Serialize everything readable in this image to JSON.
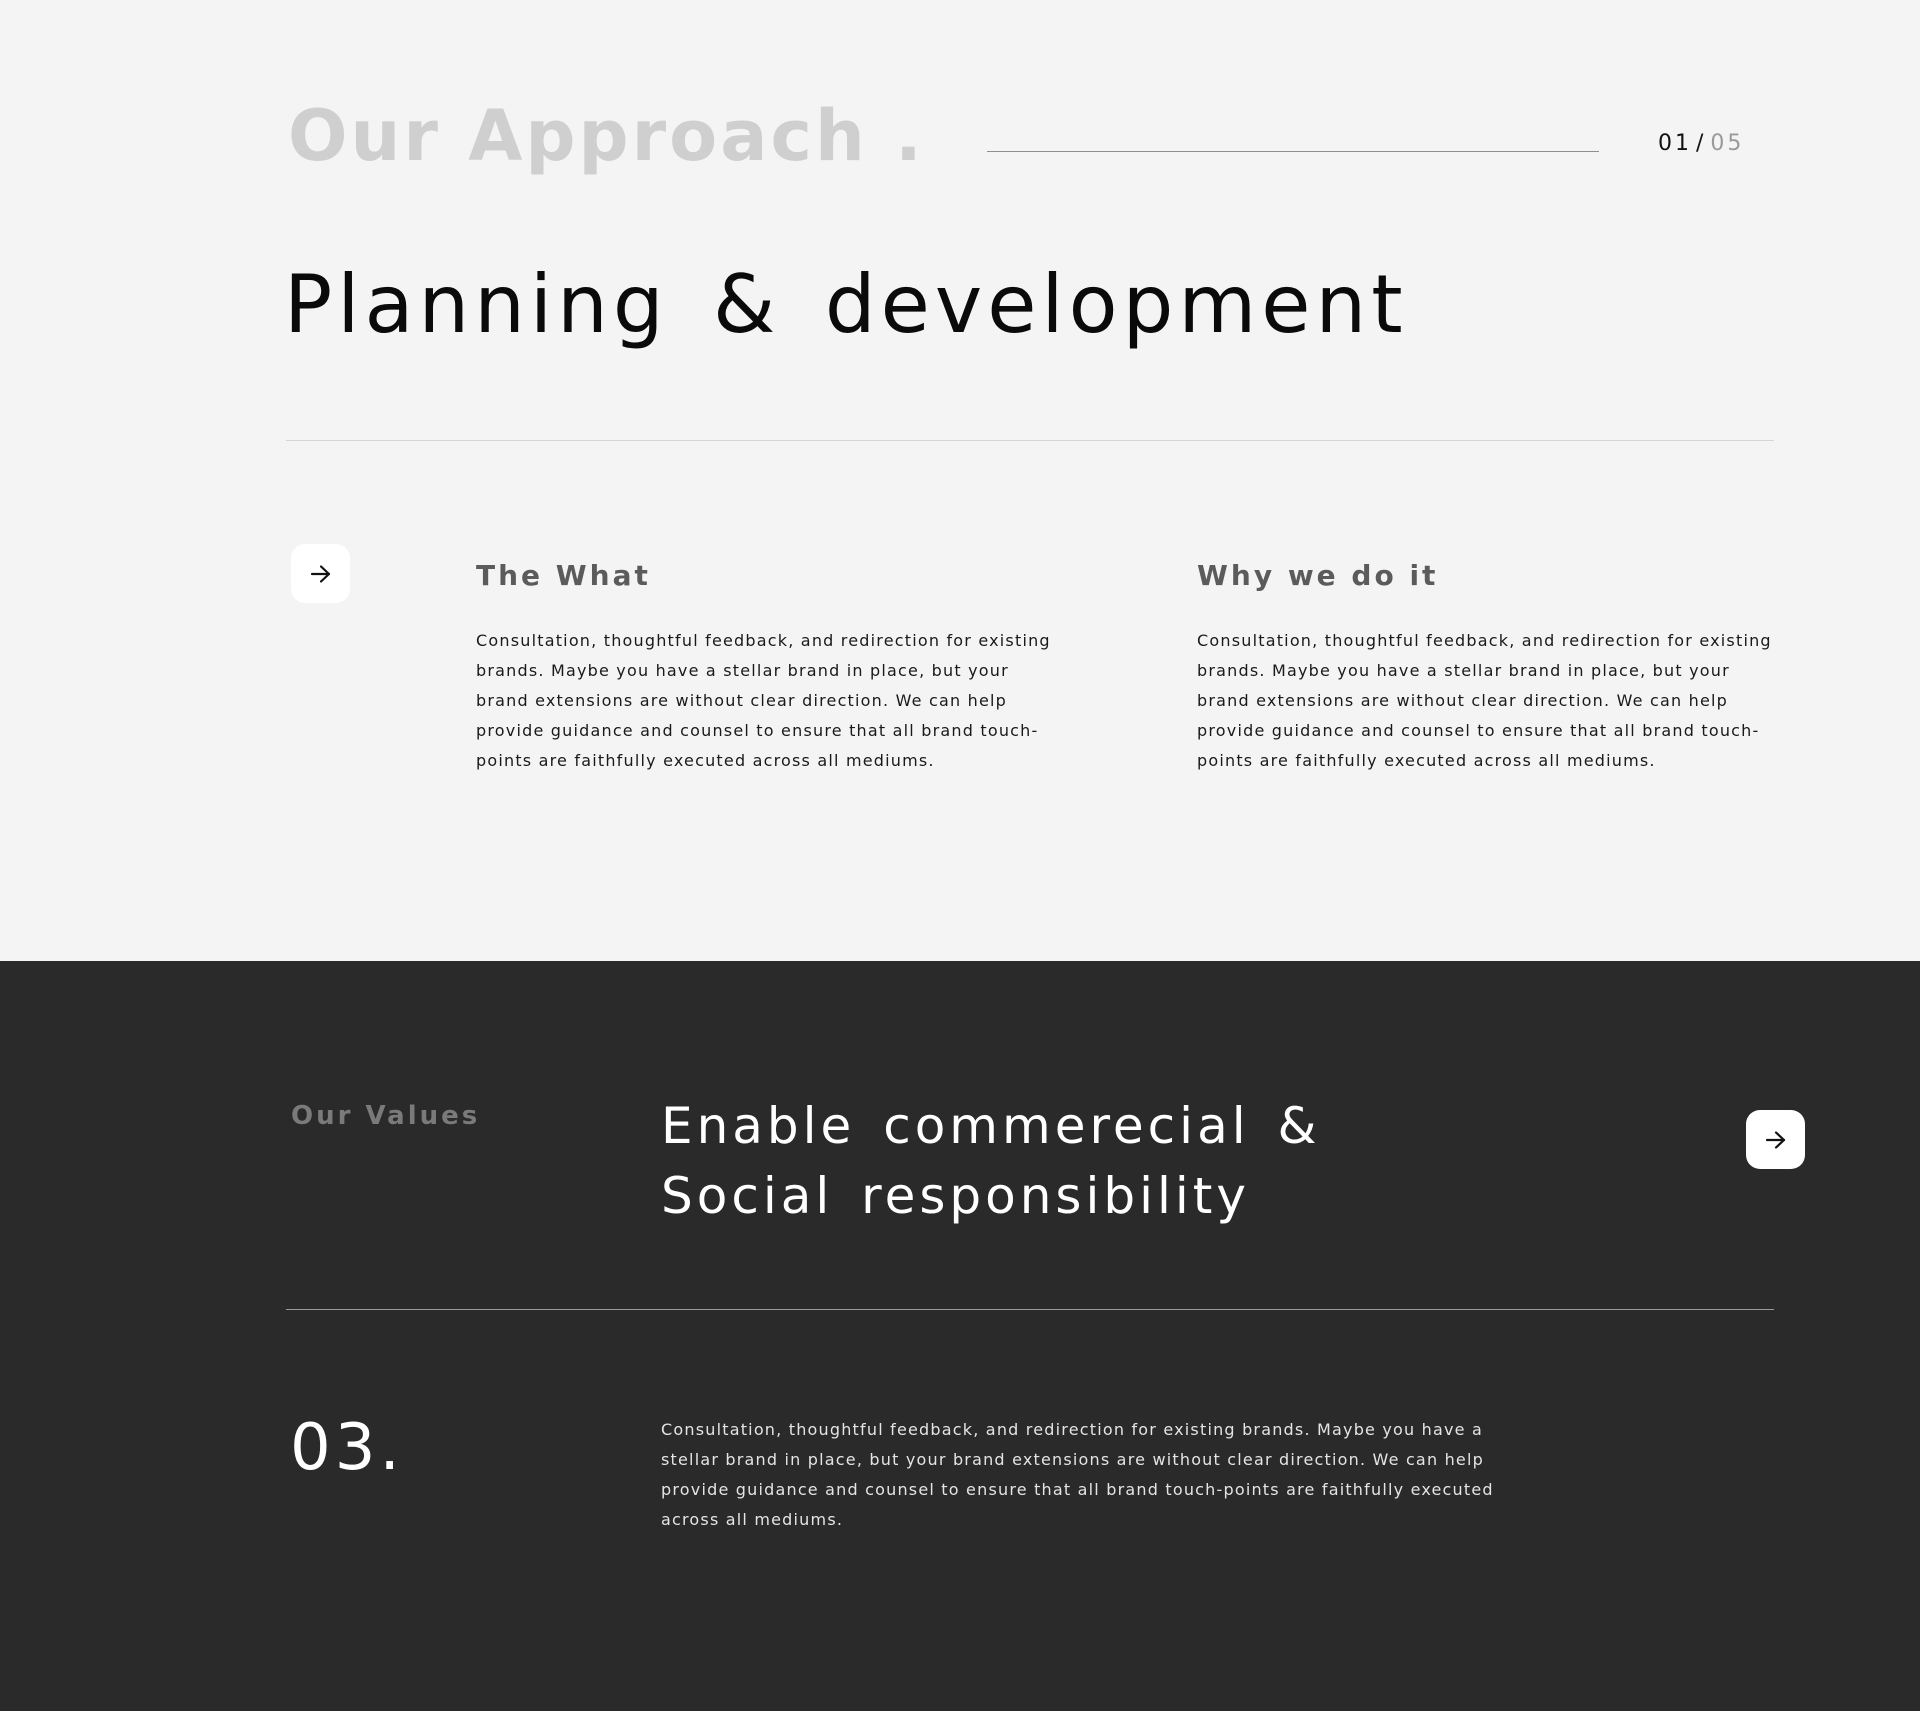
{
  "approach": {
    "title": "Our Approach .",
    "counter_current": "01",
    "counter_separator": "/",
    "counter_total": "05",
    "heading": "Planning & development",
    "arrow_icon": "arrow-right-icon",
    "columns": [
      {
        "title": "The What",
        "body": "Consultation, thoughtful feedback, and redirection for existing brands. Maybe you have a stellar brand in place, but your brand extensions are without clear direction. We can help provide guidance and counsel to ensure that all brand touch-points are faithfully executed across all mediums."
      },
      {
        "title": "Why we do it",
        "body": "Consultation, thoughtful feedback, and redirection for existing brands. Maybe you have a stellar brand in place, but your brand extensions are without clear direction. We can help provide guidance and counsel to ensure that all brand touch-points are faithfully executed across all mediums."
      }
    ]
  },
  "values": {
    "label": "Our Values",
    "heading_line1": "Enable commerecial &",
    "heading_line2": "Social responsibility",
    "arrow_icon": "arrow-right-icon",
    "number": "03.",
    "body": "Consultation, thoughtful feedback, and redirection for existing brands. Maybe you have a stellar brand in place, but your brand extensions are without clear direction. We can help provide guidance and counsel to ensure that all brand touch-points are faithfully executed across all mediums."
  },
  "colors": {
    "light_background": "#f4f4f4",
    "dark_background": "#2a2a2a",
    "muted_title": "#cfcfcf",
    "button_background": "#ffffff"
  }
}
